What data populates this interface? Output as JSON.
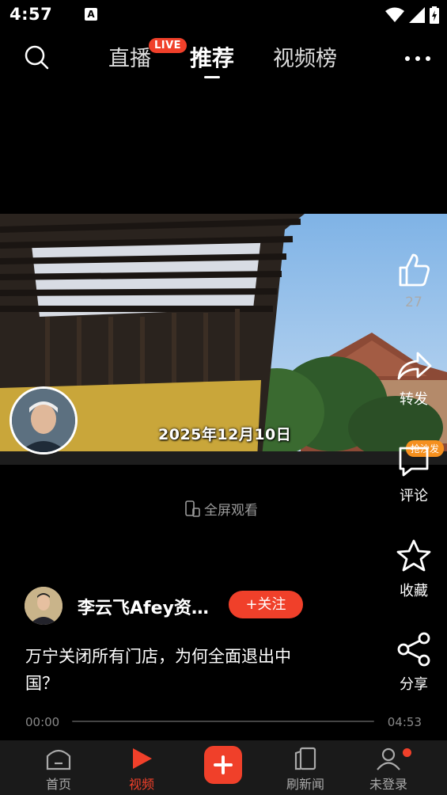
{
  "status_bar": {
    "time": "4:57",
    "notification_letter": "A"
  },
  "top_nav": {
    "tabs": [
      {
        "label": "直播"
      },
      {
        "label": "推荐"
      },
      {
        "label": "视频榜"
      }
    ],
    "live_badge": "LIVE",
    "active_tab": "推荐"
  },
  "video": {
    "date_overlay": "2025年12月10日",
    "fullscreen_label": "全屏观看"
  },
  "actions": {
    "like_count": "27",
    "forward_label": "转发",
    "comment_label": "评论",
    "comment_badge": "抢沙发",
    "collect_label": "收藏",
    "share_label": "分享"
  },
  "author": {
    "name": "李云飞Afey资…",
    "follow_label": "+关注"
  },
  "post": {
    "title": "万宁关闭所有门店，为何全面退出中国？"
  },
  "player": {
    "current_time": "00:00",
    "total_time": "04:53",
    "progress": 0
  },
  "bottom_nav": {
    "items": [
      {
        "label": "首页"
      },
      {
        "label": "视频"
      },
      {
        "label": "刷新闻"
      },
      {
        "label": "未登录"
      }
    ],
    "active": "视频"
  },
  "colors": {
    "accent": "#f0402a",
    "sofa_badge": "#f5901e",
    "background": "#000000"
  }
}
